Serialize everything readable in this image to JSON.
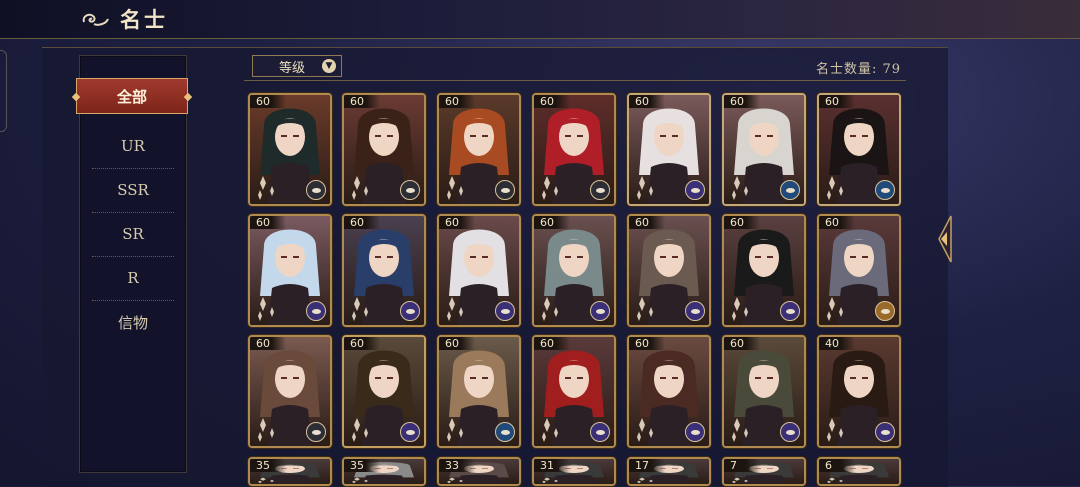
{
  "header": {
    "title": "名士"
  },
  "sidebar": {
    "items": [
      {
        "label": "全部",
        "active": true
      },
      {
        "label": "UR"
      },
      {
        "label": "SSR"
      },
      {
        "label": "SR"
      },
      {
        "label": "R"
      },
      {
        "label": "信物"
      }
    ]
  },
  "sort": {
    "label": "等级"
  },
  "count": {
    "label": "名士数量: 79"
  },
  "cards": [
    {
      "level": "60",
      "frame": "#b08a4e",
      "bg": "#6a3b2a",
      "hair": "#1f2a2a",
      "badge": "#2d2d35"
    },
    {
      "level": "60",
      "frame": "#b08a4e",
      "bg": "#6a3b33",
      "hair": "#3a2218",
      "badge": "#2d2d35"
    },
    {
      "level": "60",
      "frame": "#b08a4e",
      "bg": "#5a3a2a",
      "hair": "#a84a22",
      "badge": "#2d2d35"
    },
    {
      "level": "60",
      "frame": "#b08a4e",
      "bg": "#5e2d2a",
      "hair": "#b01e28",
      "badge": "#2d2d35"
    },
    {
      "level": "60",
      "frame": "#c4a878",
      "bg": "#7a5a5a",
      "hair": "#e6e0e0",
      "badge": "#3b2f78"
    },
    {
      "level": "60",
      "frame": "#c4a878",
      "bg": "#7a5a5a",
      "hair": "#d8d4d0",
      "badge": "#1f4a7a"
    },
    {
      "level": "60",
      "frame": "#c4a878",
      "bg": "#5a3030",
      "hair": "#1a1414",
      "badge": "#1f4a7a"
    },
    {
      "level": "60",
      "frame": "#b08a4e",
      "bg": "#7a5a60",
      "hair": "#c4d8ec",
      "badge": "#3b2f78"
    },
    {
      "level": "60",
      "frame": "#b08a4e",
      "bg": "#4a4050",
      "hair": "#2a3e6a",
      "badge": "#3b2f78"
    },
    {
      "level": "60",
      "frame": "#b08a4e",
      "bg": "#6a4a4a",
      "hair": "#e2e0e2",
      "badge": "#3b2f78"
    },
    {
      "level": "60",
      "frame": "#b08a4e",
      "bg": "#6a5050",
      "hair": "#7a8a8a",
      "badge": "#3b2f78"
    },
    {
      "level": "60",
      "frame": "#b08a4e",
      "bg": "#6a5050",
      "hair": "#6a5a50",
      "badge": "#3b2f78"
    },
    {
      "level": "60",
      "frame": "#b08a4e",
      "bg": "#5a4040",
      "hair": "#1a1a1a",
      "badge": "#3b2f78"
    },
    {
      "level": "60",
      "frame": "#b08a4e",
      "bg": "#5a3a3a",
      "hair": "#6a6a7a",
      "badge": "#9a6a2a"
    },
    {
      "level": "60",
      "frame": "#b08a4e",
      "bg": "#7a5a50",
      "hair": "#6a4a3a",
      "badge": "#2d2d35"
    },
    {
      "level": "60",
      "frame": "#c4a060",
      "bg": "#5a4a3a",
      "hair": "#3a2a1a",
      "badge": "#3b2f78"
    },
    {
      "level": "60",
      "frame": "#b08a4e",
      "bg": "#6a5a4a",
      "hair": "#9a7a5a",
      "badge": "#1f4a7a"
    },
    {
      "level": "60",
      "frame": "#b08a4e",
      "bg": "#5a3a3a",
      "hair": "#a01e1e",
      "badge": "#3b2f78"
    },
    {
      "level": "60",
      "frame": "#b08a4e",
      "bg": "#6a4a40",
      "hair": "#4a2a22",
      "badge": "#3b2f78"
    },
    {
      "level": "60",
      "frame": "#b08a4e",
      "bg": "#5a4a3a",
      "hair": "#4a4a3a",
      "badge": "#3b2f78"
    },
    {
      "level": "40",
      "frame": "#b08a4e",
      "bg": "#5a3a30",
      "hair": "#2a1a14",
      "badge": "#3b2f78"
    },
    {
      "level": "35",
      "frame": "#b08a4e",
      "bg": "#4a3a3a",
      "hair": "#3a3a3a",
      "badge": "#2d2d35"
    },
    {
      "level": "35",
      "frame": "#b08a4e",
      "bg": "#4a3a3a",
      "hair": "#8a8a8a",
      "badge": "#2d2d35"
    },
    {
      "level": "33",
      "frame": "#b08a4e",
      "bg": "#4a3a3a",
      "hair": "#5a4a4a",
      "badge": "#2d2d35"
    },
    {
      "level": "31",
      "frame": "#b08a4e",
      "bg": "#4a3a3a",
      "hair": "#3a3a3a",
      "badge": "#2d2d35"
    },
    {
      "level": "17",
      "frame": "#b08a4e",
      "bg": "#4a3a3a",
      "hair": "#3a3a3a",
      "badge": "#2d2d35"
    },
    {
      "level": "7",
      "frame": "#b08a4e",
      "bg": "#4a3a3a",
      "hair": "#3a3a3a",
      "badge": "#2d2d35"
    },
    {
      "level": "6",
      "frame": "#b08a4e",
      "bg": "#4a3a3a",
      "hair": "#3a3a3a",
      "badge": "#2d2d35"
    }
  ]
}
